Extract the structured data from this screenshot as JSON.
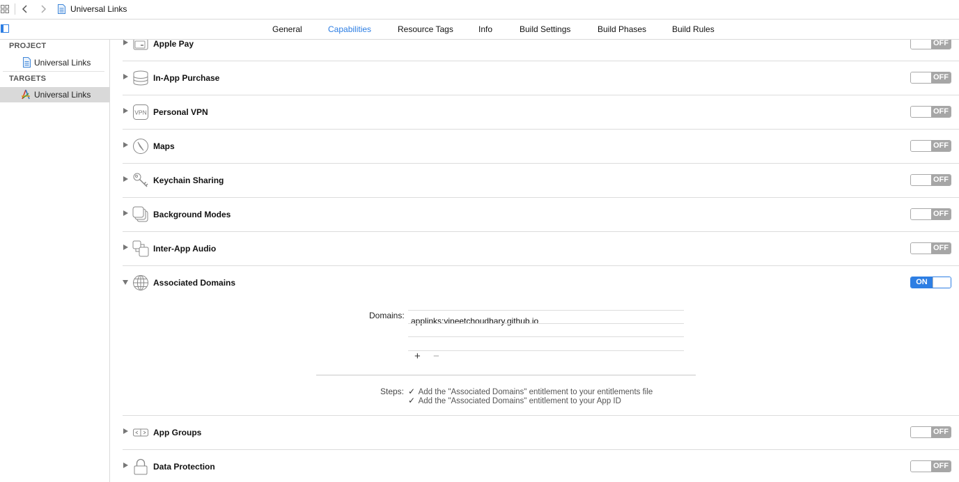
{
  "window": {
    "breadcrumb": "Universal Links"
  },
  "tabs": [
    {
      "label": "General",
      "active": false
    },
    {
      "label": "Capabilities",
      "active": true
    },
    {
      "label": "Resource Tags",
      "active": false
    },
    {
      "label": "Info",
      "active": false
    },
    {
      "label": "Build Settings",
      "active": false
    },
    {
      "label": "Build Phases",
      "active": false
    },
    {
      "label": "Build Rules",
      "active": false
    }
  ],
  "sidebar": {
    "project_heading": "PROJECT",
    "project_item": "Universal Links",
    "targets_heading": "TARGETS",
    "target_item": "Universal Links"
  },
  "capabilities": [
    {
      "name": "Apple Pay",
      "icon": "apple-pay-icon",
      "state": "OFF"
    },
    {
      "name": "In-App Purchase",
      "icon": "in-app-purchase-icon",
      "state": "OFF"
    },
    {
      "name": "Personal VPN",
      "icon": "vpn-icon",
      "state": "OFF",
      "icon_text": "VPN"
    },
    {
      "name": "Maps",
      "icon": "maps-icon",
      "state": "OFF"
    },
    {
      "name": "Keychain Sharing",
      "icon": "keychain-icon",
      "state": "OFF"
    },
    {
      "name": "Background Modes",
      "icon": "background-modes-icon",
      "state": "OFF"
    },
    {
      "name": "Inter-App Audio",
      "icon": "inter-app-audio-icon",
      "state": "OFF"
    },
    {
      "name": "Associated Domains",
      "icon": "globe-icon",
      "state": "ON"
    },
    {
      "name": "App Groups",
      "icon": "app-groups-icon",
      "state": "OFF"
    },
    {
      "name": "Data Protection",
      "icon": "lock-icon",
      "state": "OFF"
    }
  ],
  "associated_domains": {
    "domains_label": "Domains:",
    "domains": [
      "applinks:vineetchoudhary.github.io"
    ],
    "add_symbol": "+",
    "remove_symbol": "−",
    "steps_label": "Steps:",
    "steps": [
      "Add the \"Associated Domains\" entitlement to your entitlements file",
      "Add the \"Associated Domains\" entitlement to your App ID"
    ],
    "check_symbol": "✓"
  },
  "colors": {
    "accent": "#2d7ee3",
    "toggle_off": "#a6a6a6"
  }
}
